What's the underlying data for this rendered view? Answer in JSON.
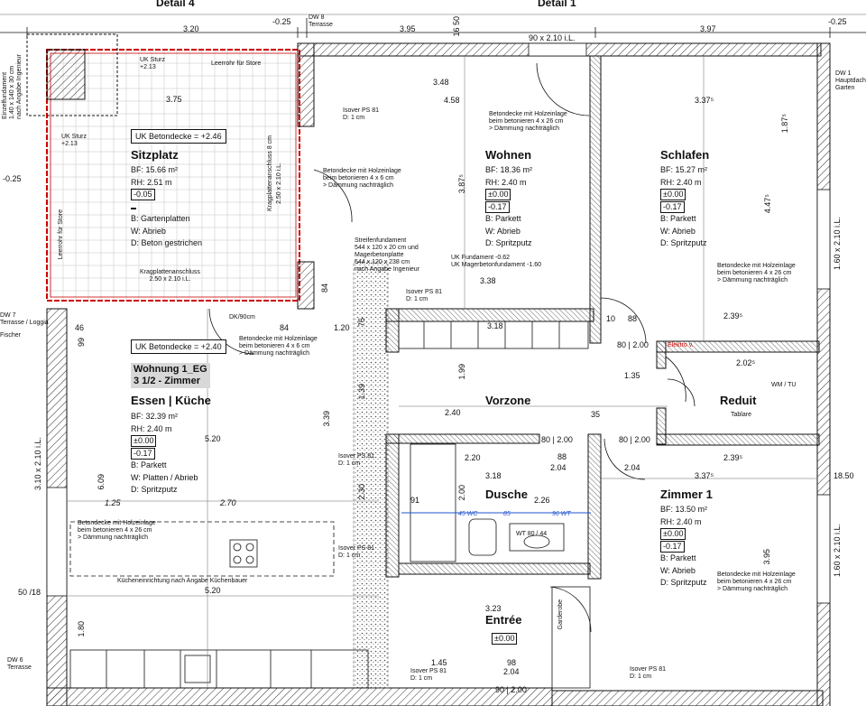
{
  "details": {
    "left": "Detail 4",
    "right": "Detail 1"
  },
  "apartment": {
    "name": "Wohnung 1_EG",
    "type": "3 1/2 - Zimmer"
  },
  "rooms": {
    "sitzplatz": {
      "name": "Sitzplatz",
      "bf": "BF: 15.66 m²",
      "rh": "RH:  2.51 m",
      "lvl1": "-0.05",
      "lvl2": "",
      "b": "B: Gartenplatten",
      "w": "W: Abrieb",
      "d": "D: Beton gestrichen"
    },
    "wohnen": {
      "name": "Wohnen",
      "bf": "BF: 18.36 m²",
      "rh": "RH:  2.40 m",
      "lvl1": "±0.00",
      "lvl2": "-0.17",
      "b": "B: Parkett",
      "w": "W: Abrieb",
      "d": "D: Spritzputz"
    },
    "schlafen": {
      "name": "Schlafen",
      "bf": "BF: 15.27 m²",
      "rh": "RH:  2.40 m",
      "lvl1": "±0.00",
      "lvl2": "-0.17",
      "b": "B: Parkett",
      "w": "W: Abrieb",
      "d": "D: Spritzputz"
    },
    "essen": {
      "name": "Essen | Küche",
      "bf": "BF: 32.39 m²",
      "rh": "RH:  2.40 m",
      "lvl1": "±0.00",
      "lvl2": "-0.17",
      "b": "B: Parkett",
      "w": "W: Platten / Abrieb",
      "d": "D: Spritzputz"
    },
    "zimmer1": {
      "name": "Zimmer 1",
      "bf": "BF: 13.50 m²",
      "rh": "RH:  2.40 m",
      "lvl1": "±0.00",
      "lvl2": "-0.17",
      "b": "B: Parkett",
      "w": "W: Abrieb",
      "d": "D: Spritzputz"
    },
    "vorzone": {
      "name": "Vorzone"
    },
    "reduit": {
      "name": "Reduit",
      "note": "Tablare"
    },
    "dusche": {
      "name": "Dusche"
    },
    "entree": {
      "name": "Entrée",
      "lvl": "±0.00"
    }
  },
  "uk_boxes": {
    "sitzplatz": "UK Betondecke = +2.46",
    "essen": "UK Betondecke = +2.40"
  },
  "notes": {
    "holz1": "Betondecke mit Holzeinlage\nbeim betonieren 4 x 26 cm\n> Dämmung nachträglich",
    "holz2": "Betondecke mit Holzeinlage\nbeim betonieren 4 x 6 cm\n> Dämmung nachträglich",
    "fund": "Streifenfundament\n544 x 120 x 20 cm und\nMagerbetonplatte\n544 x 120 x 238 cm\nnach Angabe Ingenieur",
    "ukfund": "UK Fundament -0.62\nUK Magerbetonfundament -1.60",
    "isover": "Isover PS 81\nD: 1 cm",
    "kragl": "Kragplattenanschluss\n2.50 x 2.10 i.L.",
    "kragv": "Kragplattenanschluss 8 cm",
    "kragv2": "2.50 x 2.10 i.L.",
    "kueche": "Kücheneinrichtung nach Angabe Küchenbauer",
    "ukst1": "UK Sturz\n+2.13",
    "ukst2": "UK Sturz\n+2.13",
    "leerstore": "Leerrohr für Store",
    "leerstore2": "Leerrohr für Store",
    "dw8": "DW 8\nTerrasse",
    "dw7": "DW 7\nTerrasse / Loggia",
    "dw6": "DW 6\nTerrasse",
    "dw1": "DW 1\nHauptdach\nGarten",
    "einzel": "Einzelfundament\n1.40 x 140 x 30 cm\nnach Angabe Ingenieur",
    "wmtu": "WM / TU",
    "wt": "WT 80 / 44",
    "eltab": "Elektro v.",
    "garderobe": "Garderobe",
    "fischer": "Fischer"
  },
  "dims": {
    "top_320": "3.20",
    "top_395": "3.95",
    "top_397": "3.97",
    "top_1650": "16 50",
    "d_375": "3.75",
    "d_348": "3.48",
    "d_458": "4.58",
    "d_337a": "3.37⁵",
    "d_338": "3.38",
    "d_318": "3.18",
    "d_239a": "2.39⁵",
    "d_202": "2.02⁵",
    "d_135": "1.35",
    "d_240": "2.40",
    "d_220": "2.20",
    "d_318b": "3.18",
    "d_337b": "3.37⁵",
    "d_239b": "2.39⁵",
    "d_226": "2.26",
    "d_323": "3.23",
    "d_145": "1.45",
    "d_204a": "2.04",
    "d_204b": "2.04",
    "d_204c": "2.04",
    "d_520": "5.20",
    "d_125": "1.25",
    "d_270": "2.70",
    "d_609": "6.09",
    "d_339": "3.39",
    "d_199": "1.99",
    "d_139": "1.39",
    "d_200": "2.00",
    "d_230": "2.30",
    "d_387": "3.87⁵",
    "d_447": "4.47⁵",
    "d_187": "1.87⁵",
    "d_395": "3.95",
    "d_1850": "18.50",
    "d_84a": "84",
    "d_84b": "84",
    "d_120": "1.20",
    "d_75": "75",
    "d_46": "46",
    "d_99": "99",
    "d_180": "1.80",
    "d_50_18": "50 /18",
    "d_025a": "-0.25",
    "d_025b": "-0.25",
    "d_025c": "-0.25",
    "d_025d": "-0.25",
    "op_90": "90 x 2.10 i.L.",
    "op_310": "3.10 x 2.10 i.L.",
    "op_160a": "1.60 x 2.10 i.L.",
    "op_160b": "1.60 x 2.10 i.L.",
    "op_80_200a": "80 | 2.00",
    "op_80_200b": "80 | 2.00",
    "op_80_200c": "80 | 2.00",
    "op_90_200": "90 | 2.00",
    "op_dk90": "DK/90cm",
    "wc": "45 WC",
    "v85": "85",
    "wt96": "96 WT",
    "d_91": "91",
    "d_88a": "88",
    "d_88b": "88",
    "d_35": "35",
    "d_98": "98",
    "d_10": "10"
  }
}
